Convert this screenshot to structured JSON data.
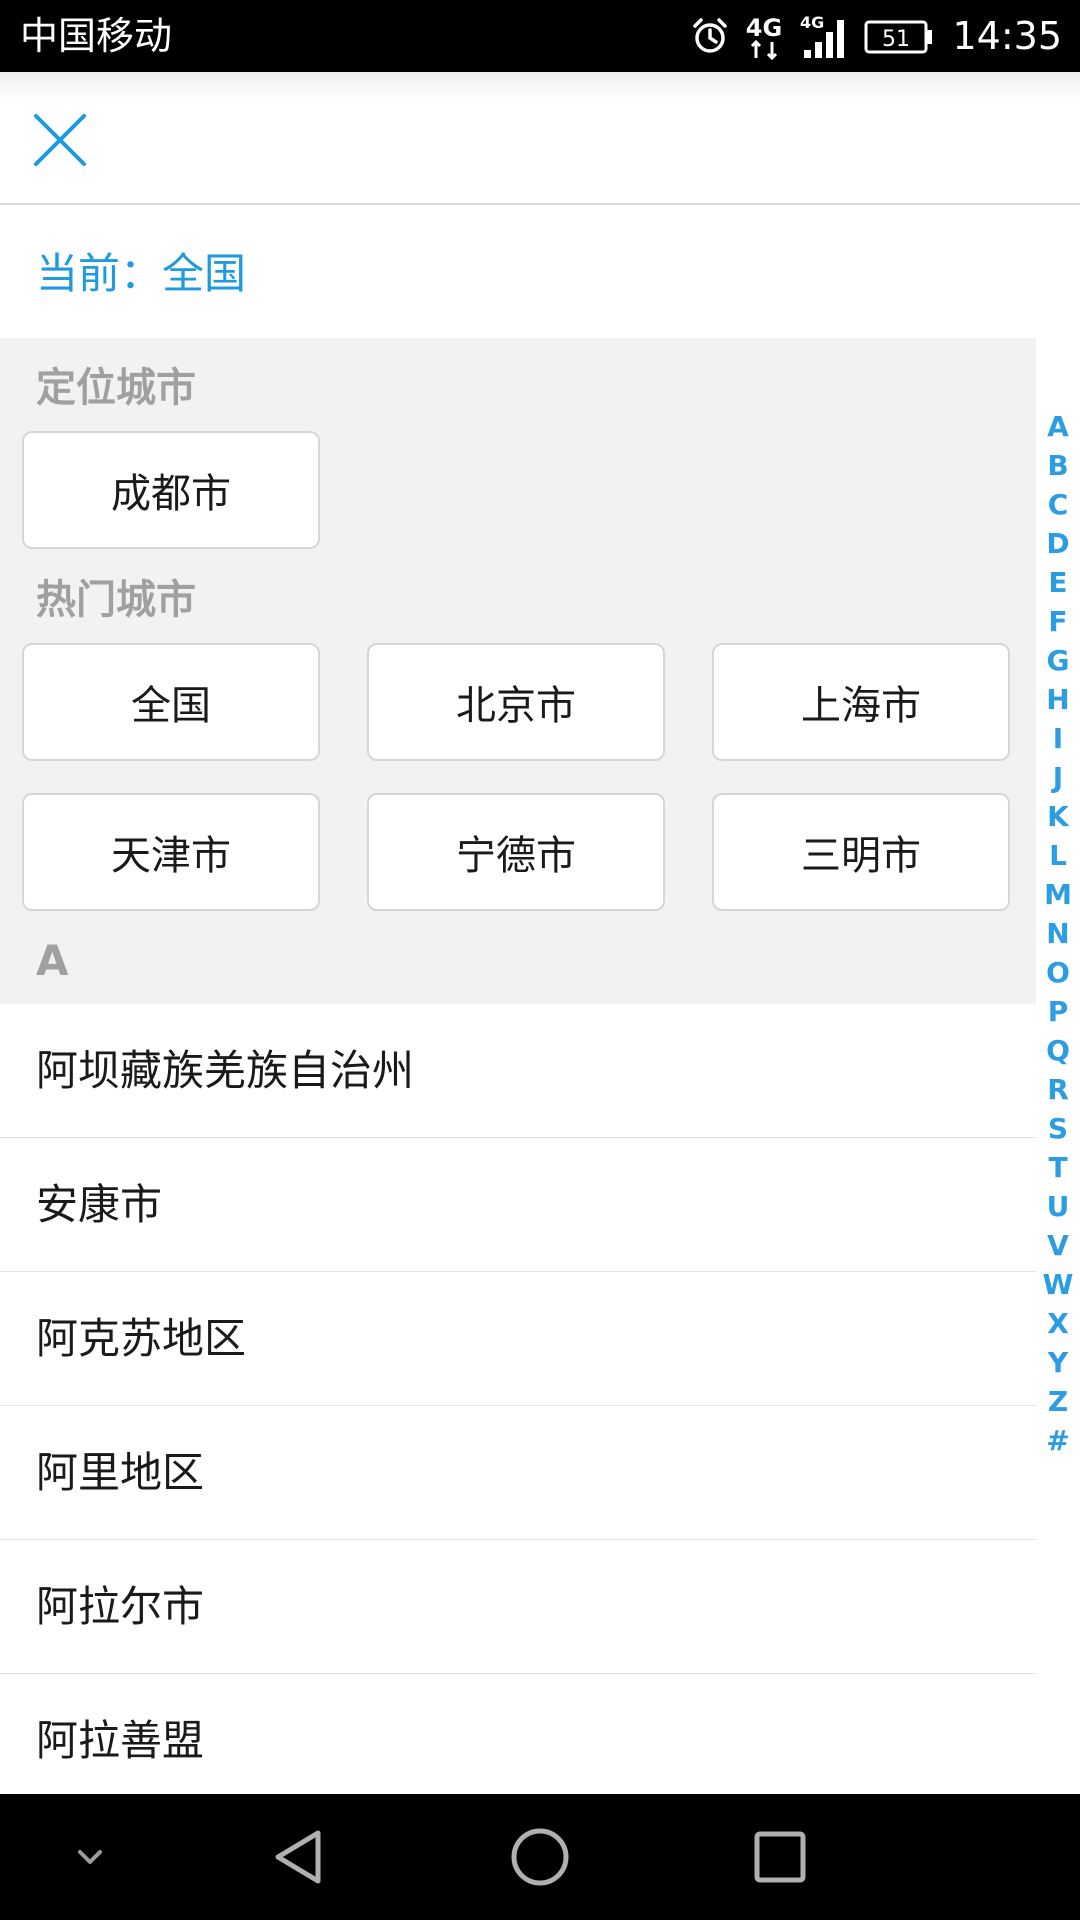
{
  "status_bar": {
    "carrier": "中国移动",
    "network_1": "4G",
    "network_2": "4G",
    "battery": "51",
    "time": "14:35",
    "icons": [
      "alarm-icon",
      "data-4g-icon",
      "signal-icon",
      "battery-icon"
    ]
  },
  "header": {
    "close_icon": "close-icon"
  },
  "current": {
    "text": "当前：全国"
  },
  "location_section": {
    "title": "定位城市",
    "city": "成都市"
  },
  "hot_section": {
    "title": "热门城市",
    "cities": [
      "全国",
      "北京市",
      "上海市",
      "天津市",
      "宁德市",
      "三明市"
    ]
  },
  "list_section": {
    "letter": "A",
    "cities": [
      "阿坝藏族羌族自治州",
      "安康市",
      "阿克苏地区",
      "阿里地区",
      "阿拉尔市",
      "阿拉善盟"
    ]
  },
  "index_bar": {
    "letters": [
      "A",
      "B",
      "C",
      "D",
      "E",
      "F",
      "G",
      "H",
      "I",
      "J",
      "K",
      "L",
      "M",
      "N",
      "O",
      "P",
      "Q",
      "R",
      "S",
      "T",
      "U",
      "V",
      "W",
      "X",
      "Y",
      "Z",
      "#"
    ]
  },
  "nav_bar": {
    "icons": [
      "chevron-down-icon",
      "back-icon",
      "home-icon",
      "recents-icon"
    ]
  },
  "colors": {
    "accent": "#1e9ae0",
    "index": "#2d9de3",
    "section_bg": "#f2f2f2",
    "section_title": "#a0a0a0"
  }
}
